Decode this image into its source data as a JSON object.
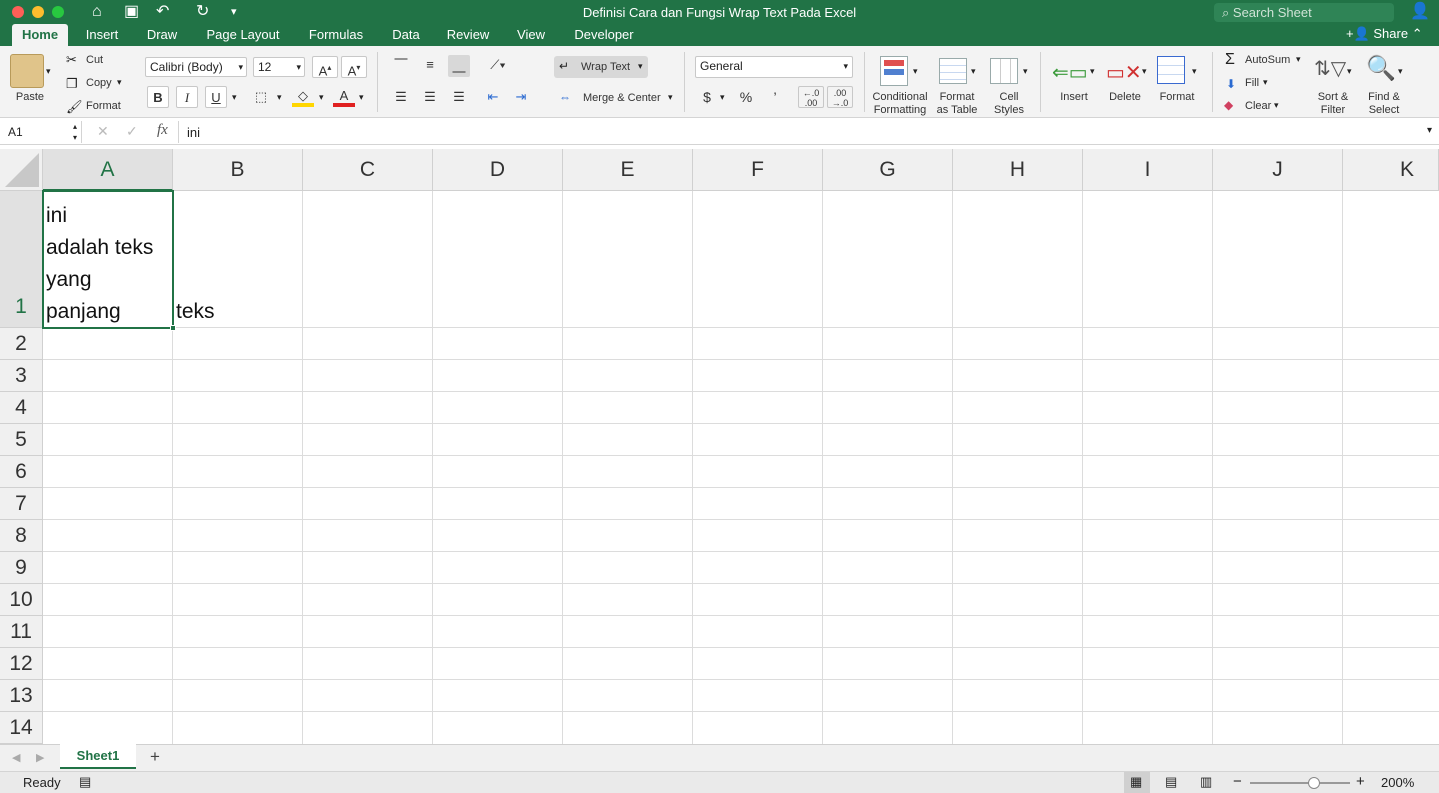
{
  "window": {
    "title": "Definisi Cara dan Fungsi Wrap Text Pada Excel",
    "search_placeholder": "Search Sheet"
  },
  "tabs": [
    "Home",
    "Insert",
    "Draw",
    "Page Layout",
    "Formulas",
    "Data",
    "Review",
    "View",
    "Developer"
  ],
  "active_tab": "Home",
  "share_label": "Share",
  "ribbon": {
    "clipboard": {
      "paste": "Paste",
      "cut": "Cut",
      "copy": "Copy",
      "format": "Format"
    },
    "font": {
      "name": "Calibri (Body)",
      "size": "12",
      "bold": "B",
      "italic": "I",
      "underline": "U"
    },
    "alignment": {
      "wrap_text": "Wrap Text",
      "merge_center": "Merge & Center"
    },
    "number": {
      "format": "General",
      "currency": "$",
      "percent": "%",
      "comma": "’"
    },
    "styles": {
      "conditional": "Conditional\nFormatting",
      "conditional_l1": "Conditional",
      "conditional_l2": "Formatting",
      "table_l1": "Format",
      "table_l2": "as Table",
      "cell_l1": "Cell",
      "cell_l2": "Styles"
    },
    "cells": {
      "insert": "Insert",
      "delete": "Delete",
      "format": "Format"
    },
    "editing": {
      "autosum": "AutoSum",
      "fill": "Fill",
      "clear": "Clear",
      "sort_l1": "Sort &",
      "sort_l2": "Filter",
      "find_l1": "Find &",
      "find_l2": "Select"
    }
  },
  "formula_bar": {
    "name_box": "A1",
    "fx": "fx",
    "formula": "ini"
  },
  "grid": {
    "columns": [
      "A",
      "B",
      "C",
      "D",
      "E",
      "F",
      "G",
      "H",
      "I",
      "J",
      "K"
    ],
    "rows": [
      "1",
      "2",
      "3",
      "4",
      "5",
      "6",
      "7",
      "8",
      "9",
      "10",
      "11",
      "12",
      "13",
      "14"
    ],
    "selected_cell": "A1",
    "cells": {
      "A1": [
        "ini",
        "adalah teks",
        "yang",
        "panjang"
      ],
      "B1": "teks"
    }
  },
  "sheets": {
    "tabs": [
      "Sheet1"
    ],
    "add": "+"
  },
  "status": {
    "ready": "Ready",
    "zoom": "200%"
  },
  "colors": {
    "accent": "#217346",
    "ribbon_bg": "#f3f3f3"
  }
}
